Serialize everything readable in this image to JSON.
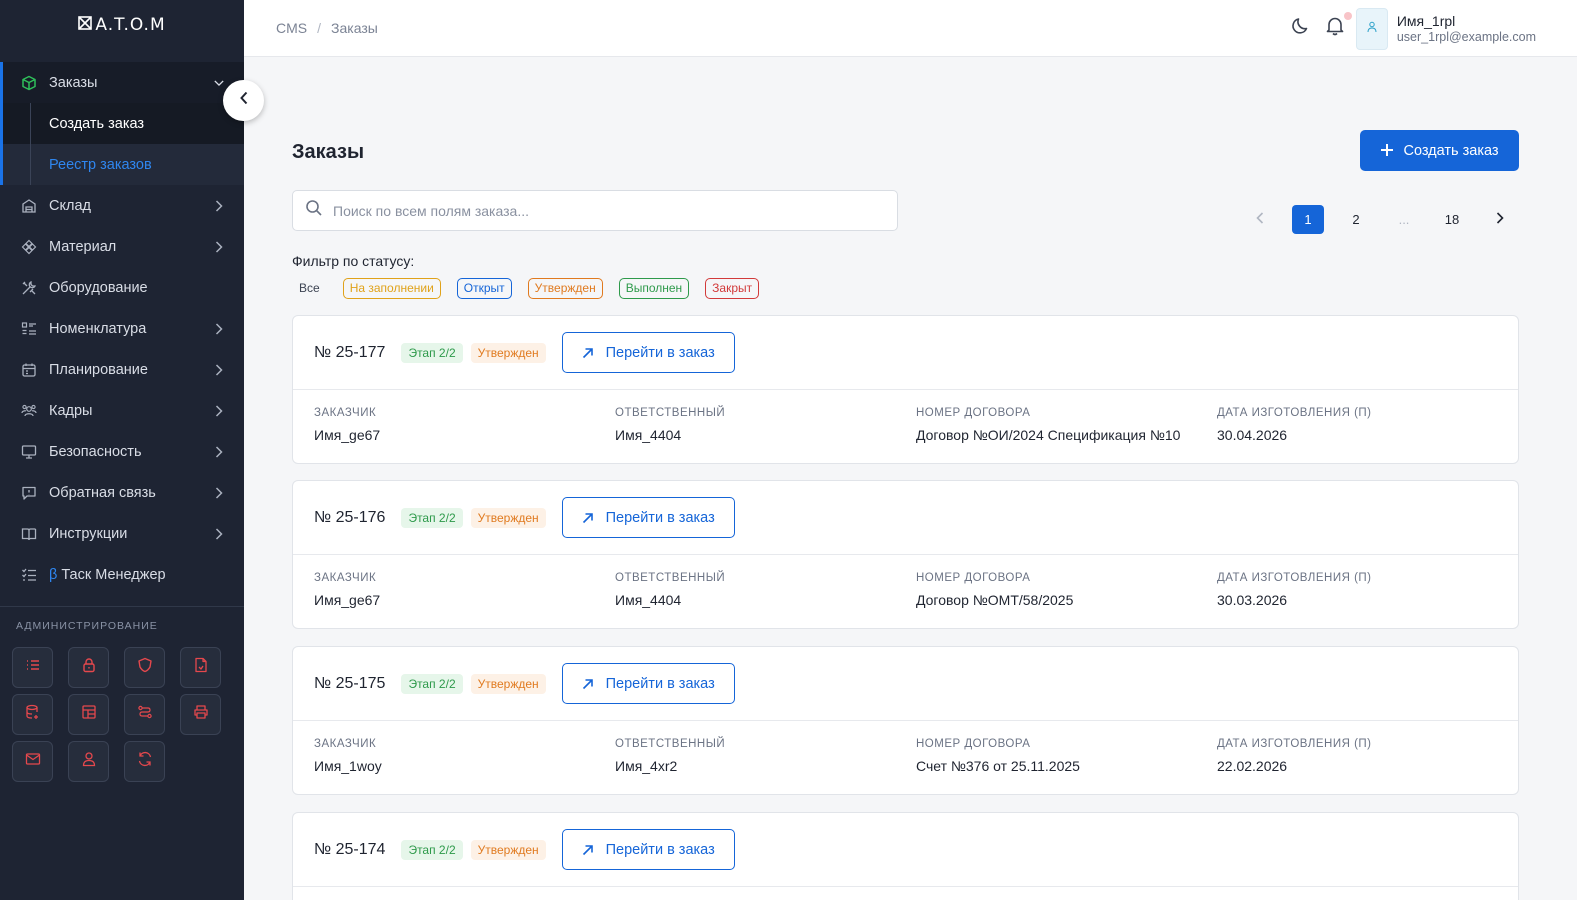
{
  "brand": {
    "logo": "A.T.O.M"
  },
  "sidebar": {
    "items": [
      {
        "label": "Заказы",
        "icon": "cube-icon"
      },
      {
        "label": "Склад",
        "icon": "warehouse-icon"
      },
      {
        "label": "Материал",
        "icon": "material-icon"
      },
      {
        "label": "Оборудование",
        "icon": "tools-icon"
      },
      {
        "label": "Номенклатура",
        "icon": "list-icon"
      },
      {
        "label": "Планирование",
        "icon": "calendar-icon"
      },
      {
        "label": "Кадры",
        "icon": "people-icon"
      },
      {
        "label": "Безопасность",
        "icon": "monitor-icon"
      },
      {
        "label": "Обратная связь",
        "icon": "feedback-icon"
      },
      {
        "label": "Инструкции",
        "icon": "book-icon"
      },
      {
        "label": "Таск Менеджер",
        "icon": "tasks-icon",
        "prefix": "β"
      }
    ],
    "sub_items": [
      {
        "label": "Создать заказ"
      },
      {
        "label": "Реестр заказов"
      }
    ],
    "admin_title": "АДМИНИСТРИРОВАНИЕ"
  },
  "topbar": {
    "breadcrumb": [
      "CMS",
      "/",
      "Заказы"
    ],
    "user_name": "Имя_1rpl",
    "user_email": "user_1rpl@example.com"
  },
  "main": {
    "title": "Заказы",
    "create_button": "Создать заказ",
    "search_placeholder": "Поиск по всем полям заказа...",
    "pagination": [
      "1",
      "2",
      "...",
      "18"
    ],
    "filter_label": "Фильтр по статусу:",
    "filters": [
      {
        "label": "Все"
      },
      {
        "label": "На заполнении",
        "color": "#e0a21a"
      },
      {
        "label": "Открыт",
        "color": "#1565d8"
      },
      {
        "label": "Утвержден",
        "color": "#e07a1f"
      },
      {
        "label": "Выполнен",
        "color": "#2e9a4b"
      },
      {
        "label": "Закрыт",
        "color": "#d23a3a"
      }
    ],
    "field_labels": [
      "ЗАКАЗЧИК",
      "ОТВЕТСТВЕННЫЙ",
      "НОМЕР ДОГОВОРА",
      "ДАТА ИЗГОТОВЛЕНИЯ (П)"
    ],
    "goto_label": "Перейти в заказ",
    "orders": [
      {
        "number": "№ 25-177",
        "stage": "Этап 2/2",
        "status": "Утвержден",
        "customer": "Имя_ge67",
        "responsible": "Имя_4404",
        "contract": "Договор №ОИ/2024 Спецификация №10",
        "date": "30.04.2026"
      },
      {
        "number": "№ 25-176",
        "stage": "Этап 2/2",
        "status": "Утвержден",
        "customer": "Имя_ge67",
        "responsible": "Имя_4404",
        "contract": "Договор №ОМТ/58/2025",
        "date": "30.03.2026"
      },
      {
        "number": "№ 25-175",
        "stage": "Этап 2/2",
        "status": "Утвержден",
        "customer": "Имя_1woy",
        "responsible": "Имя_4xr2",
        "contract": "Счет №376 от 25.11.2025",
        "date": "22.02.2026"
      },
      {
        "number": "№ 25-174",
        "stage": "Этап 2/2",
        "status": "Утвержден"
      }
    ]
  },
  "colors": {
    "accent": "#1565d8",
    "sidebar_bg": "#1e2433",
    "admin_icon": "#e5484d"
  }
}
